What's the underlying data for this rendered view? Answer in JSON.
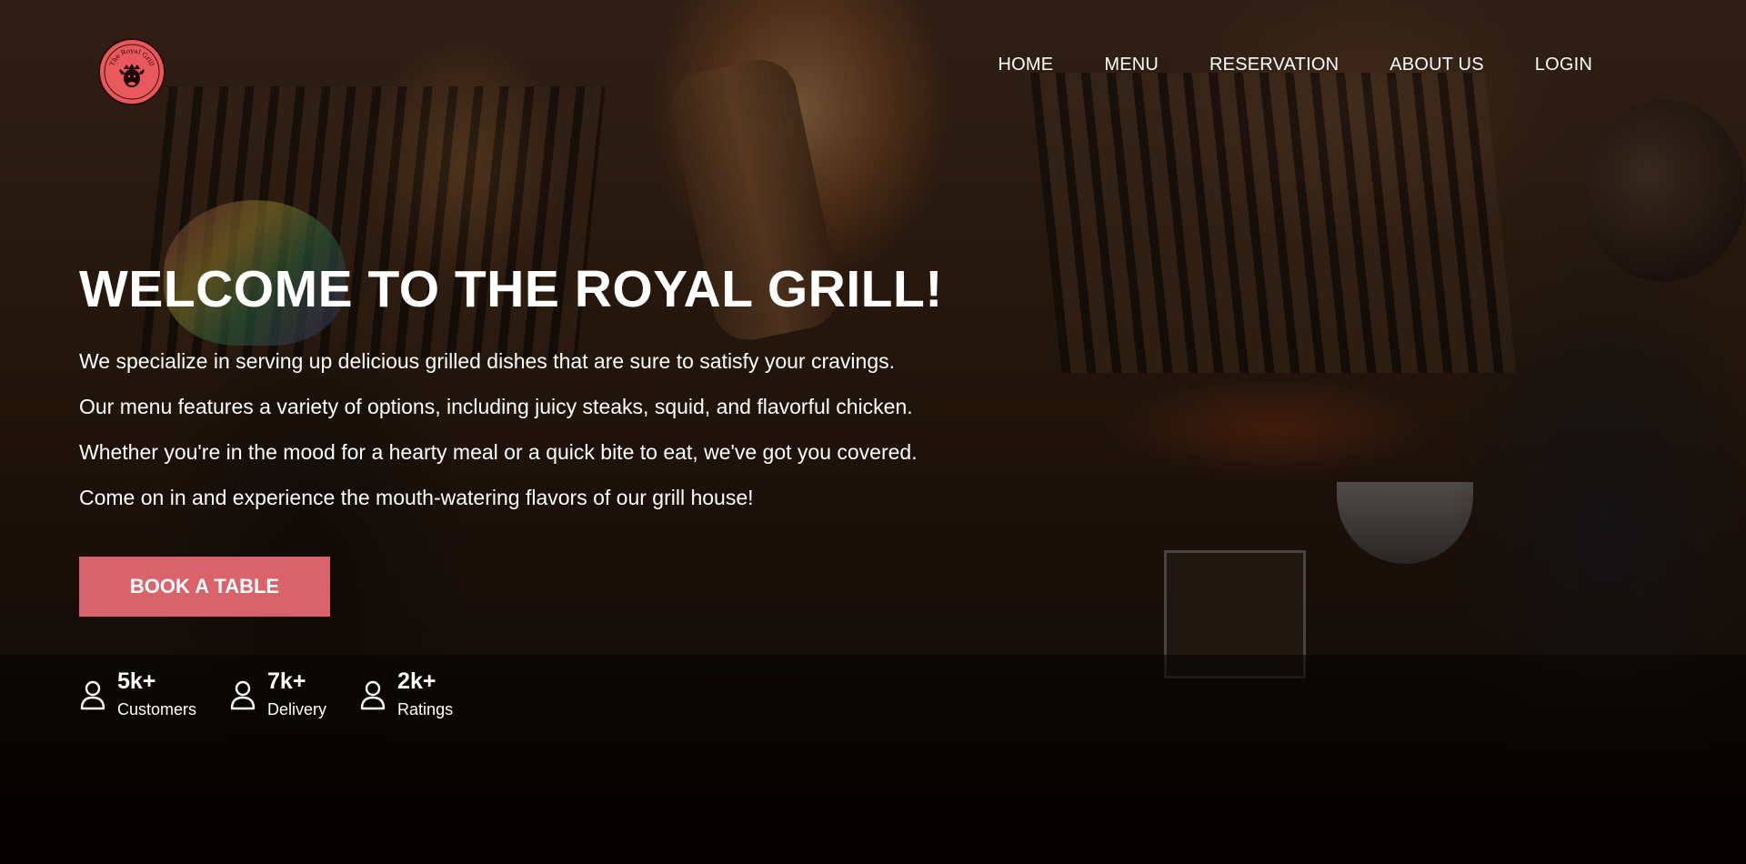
{
  "brand": {
    "logo_text": "The Royal Grill",
    "logo_color": "#e8585c"
  },
  "nav": {
    "items": [
      {
        "label": "HOME"
      },
      {
        "label": "MENU"
      },
      {
        "label": "RESERVATION"
      },
      {
        "label": "ABOUT US"
      },
      {
        "label": "LOGIN"
      }
    ]
  },
  "hero": {
    "title": "WELCOME TO THE ROYAL GRILL!",
    "paragraphs": [
      "We specialize in serving up delicious grilled dishes that are sure to satisfy your cravings.",
      "Our menu features a variety of options, including juicy steaks, squid, and flavorful chicken.",
      "Whether you're in the mood for a hearty meal or a quick bite to eat, we've got you covered.",
      "Come on in and experience the mouth-watering flavors of our grill house!"
    ],
    "cta_label": "BOOK A TABLE",
    "cta_color": "#d9636a"
  },
  "stats": [
    {
      "value": "5k+",
      "label": "Customers",
      "icon": "user-icon"
    },
    {
      "value": "7k+",
      "label": "Delivery",
      "icon": "user-icon"
    },
    {
      "value": "2k+",
      "label": "Ratings",
      "icon": "user-icon"
    }
  ]
}
